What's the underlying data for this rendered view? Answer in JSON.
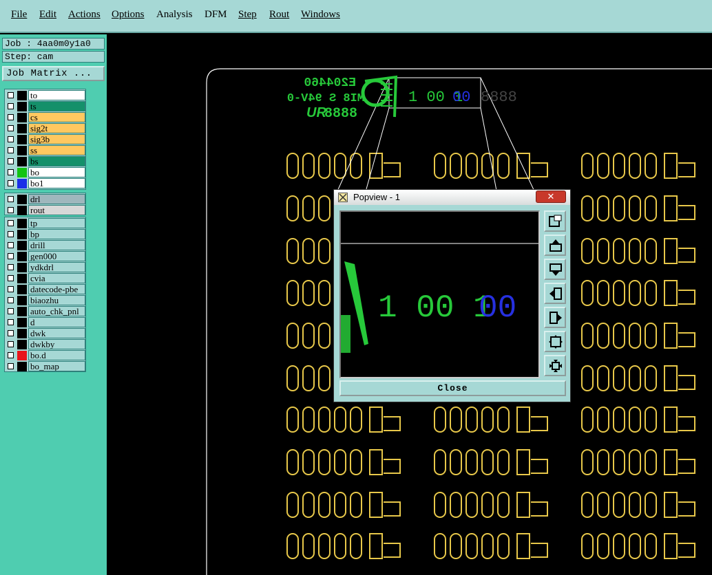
{
  "menu": [
    "File",
    "Edit",
    "Actions",
    "Options",
    "Analysis",
    "DFM",
    "Step",
    "Rout",
    "Windows"
  ],
  "job_label": "Job : 4aa0m0y1a0",
  "step_label": "Step: cam",
  "job_matrix_label": "Job Matrix ...",
  "layers_group1": [
    {
      "name": "to",
      "bg": "#ffffff",
      "swatch": "#000000"
    },
    {
      "name": "ts",
      "bg": "#15906a",
      "swatch": "#000000"
    },
    {
      "name": "cs",
      "bg": "#ffc860",
      "swatch": "#000000"
    },
    {
      "name": "sig2t",
      "bg": "#ffc860",
      "swatch": "#000000"
    },
    {
      "name": "sig3b",
      "bg": "#ffc860",
      "swatch": "#000000"
    },
    {
      "name": "ss",
      "bg": "#ffc860",
      "swatch": "#000000"
    },
    {
      "name": "bs",
      "bg": "#15906a",
      "swatch": "#000000"
    },
    {
      "name": "bo",
      "bg": "#ffffff",
      "swatch": "#12c412"
    },
    {
      "name": "bo1",
      "bg": "#ffffff",
      "swatch": "#1a2fe8"
    }
  ],
  "layers_group2": [
    {
      "name": "drl",
      "bg": "#9fb7bd",
      "swatch": "#000000"
    },
    {
      "name": "rout",
      "bg": "#d8d8d8",
      "swatch": "#000000"
    }
  ],
  "layers_group3": [
    {
      "name": "tp",
      "bg": "#a6d8d5",
      "swatch": "#000000"
    },
    {
      "name": "bp",
      "bg": "#a6d8d5",
      "swatch": "#000000"
    },
    {
      "name": "drill",
      "bg": "#a6d8d5",
      "swatch": "#000000"
    },
    {
      "name": "gen000",
      "bg": "#a6d8d5",
      "swatch": "#000000"
    },
    {
      "name": "ydkdrl",
      "bg": "#a6d8d5",
      "swatch": "#000000"
    },
    {
      "name": "cvia",
      "bg": "#a6d8d5",
      "swatch": "#000000"
    },
    {
      "name": "datecode-pbe",
      "bg": "#a6d8d5",
      "swatch": "#000000"
    },
    {
      "name": "biaozhu",
      "bg": "#a6d8d5",
      "swatch": "#000000"
    },
    {
      "name": "auto_chk_pnl",
      "bg": "#a6d8d5",
      "swatch": "#000000"
    },
    {
      "name": "d",
      "bg": "#a6d8d5",
      "swatch": "#000000"
    },
    {
      "name": "dwk",
      "bg": "#a6d8d5",
      "swatch": "#000000"
    },
    {
      "name": "dwkby",
      "bg": "#a6d8d5",
      "swatch": "#000000"
    },
    {
      "name": "bo.d",
      "bg": "#a6d8d5",
      "swatch": "#e8141a"
    },
    {
      "name": "bo_map",
      "bg": "#a6d8d5",
      "swatch": "#000000"
    }
  ],
  "board": {
    "marking_line1": "E204460",
    "marking_line2": "MI8 S 94V-0",
    "marking_line3": "8888",
    "datecode_green": "1 00 1",
    "datecode_blue": "00",
    "datecode_grey": "8888"
  },
  "popview": {
    "title": "Popview - 1",
    "close_label": "Close",
    "digits_green": "1 00 1",
    "digits_blue": "00"
  },
  "colors": {
    "menubar": "#a6d8d5",
    "panel": "#4fcdb0",
    "pad": "#e8c84a",
    "silk_green": "#27c93a",
    "blue": "#2630e0"
  }
}
